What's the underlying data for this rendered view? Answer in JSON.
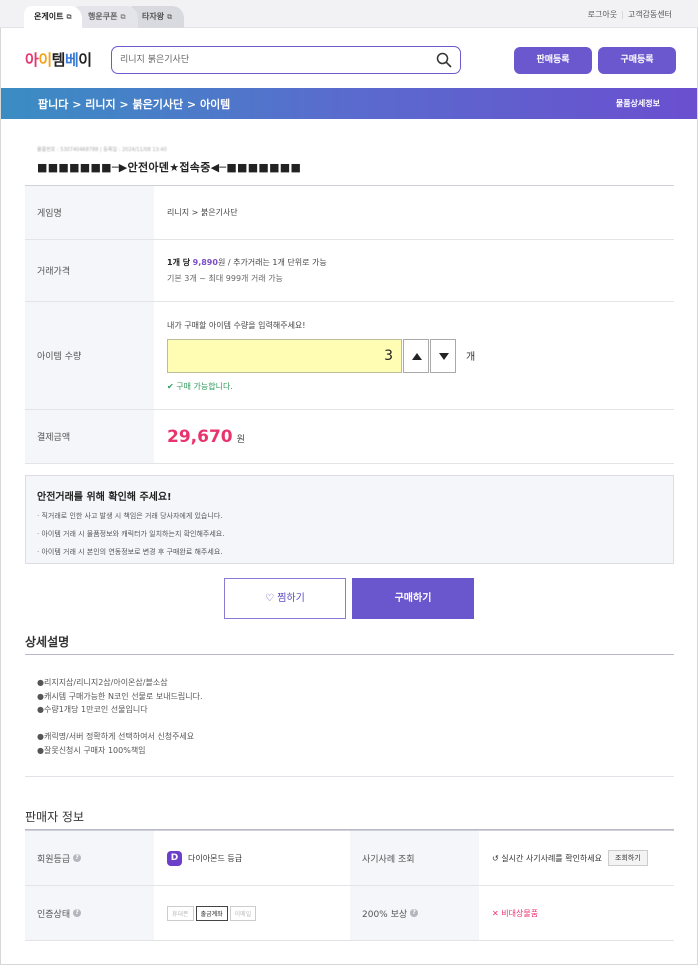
{
  "topbar": {
    "tabs": [
      "온게이트",
      "행운쿠폰",
      "타자왕"
    ],
    "links": [
      "로그아웃",
      "고객감동센터"
    ]
  },
  "header": {
    "logo": "아이템베이",
    "search_value": "리니지 붉은기사단",
    "sell_button": "판매등록",
    "buy_button": "구매등록"
  },
  "breadcrumb": {
    "path": "팝니다 >  리니지 > 붉은기사단 > 아이템",
    "detail_link": "물품상세정보"
  },
  "product": {
    "meta": "물품번호 : 530740468788  |  등록일 : 2024/11/08 13:40",
    "title": "■■■■■■■─▶안전아덴★접속중◀─■■■■■■■"
  },
  "info": {
    "game_label": "게임명",
    "game_value": "리니지 > 붉은기사단",
    "price_label": "거래가격",
    "price_prefix": "1개 당",
    "price_amount": "9,890",
    "price_suffix": "원 / 추가거래는 1개 단위로 가능",
    "price_line2": "기본 3개 ~ 최대 999개 거래 가능",
    "qty_label": "아이템 수량",
    "qty_prompt": "내가 구매할 아이템 수량을 입력해주세요!",
    "qty_value": "3",
    "qty_unit": "개",
    "qty_ok": "구매 가능합니다.",
    "total_label": "결제금액",
    "total_value": "29,670",
    "total_unit": "원"
  },
  "notice": {
    "title": "안전거래를 위해 확인해 주세요!",
    "items": [
      "직거래로 인한 사고 발생 시 책임은 거래 당사자에게 있습니다.",
      "아이템 거래 시 물품정보와 캐릭터가 일치하는지 확인해주세요.",
      "아이템 거래 시 본인의 연동정보로 변경 후 구매완료 해주세요."
    ]
  },
  "actions": {
    "wish": "찜하기",
    "buy": "구매하기"
  },
  "description": {
    "title": "상세설명",
    "lines": [
      "●리지지삽/리니지2삽/아이온삽/블소삽",
      "●캐시템 구매가능한 N코인 선물로 보내드립니다.",
      "●수량1개당 1만코인 선물입니다",
      "",
      "●캐릭명/서버 정확하게 선택하여서 신청주세요",
      "●잘못신청시 구매자 100%책임"
    ]
  },
  "seller": {
    "title": "판매자 정보",
    "grade_label": "회원등급",
    "grade_badge": "D",
    "grade_value": "다이아몬드 등급",
    "fraud_label": "사기사례 조회",
    "fraud_text": "실시간 사기사례를 확인하세요",
    "fraud_button": "조회하기",
    "auth_label": "인증상태",
    "auth_chips": [
      "휴대폰",
      "출금계좌",
      "이메일"
    ],
    "comp_label": "200% 보상",
    "comp_value": "비대상물품"
  }
}
